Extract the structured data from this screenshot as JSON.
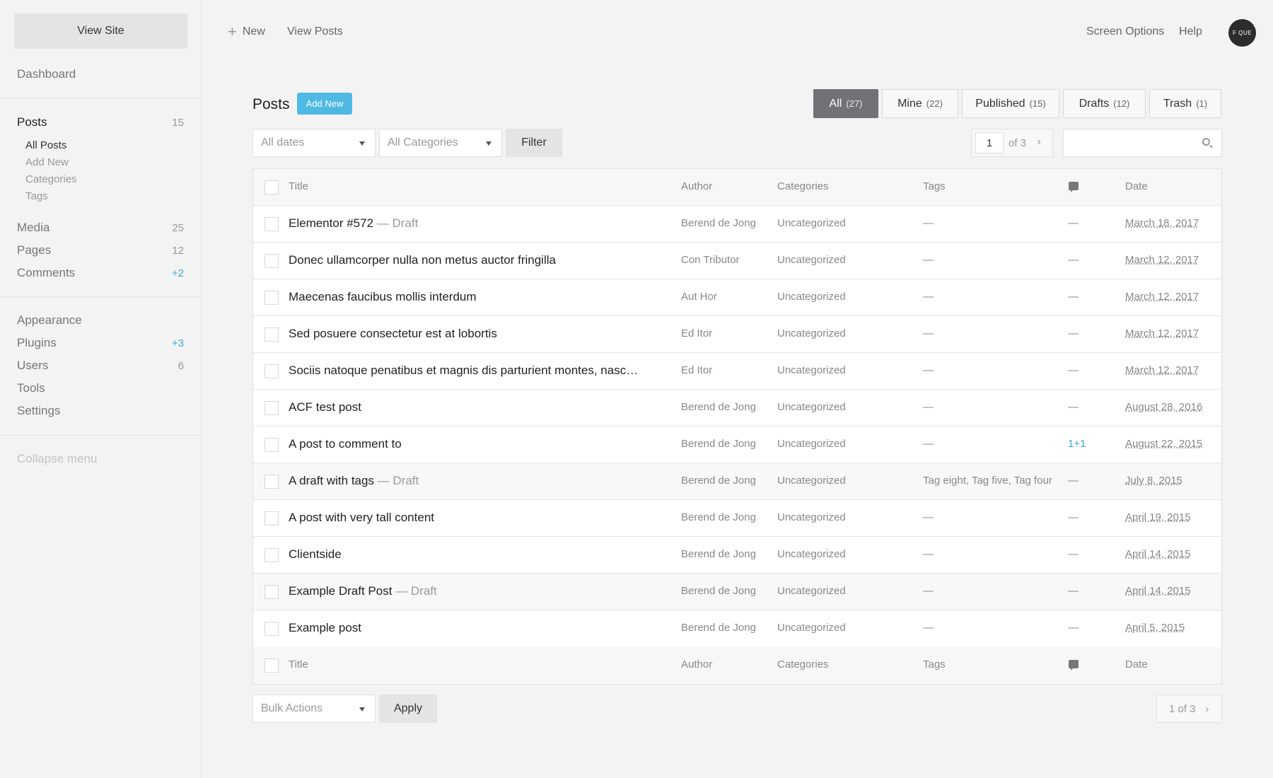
{
  "sidebar": {
    "view_site": "View Site",
    "dashboard": "Dashboard",
    "posts": {
      "label": "Posts",
      "count": "15"
    },
    "posts_sub": [
      "All Posts",
      "Add New",
      "Categories",
      "Tags"
    ],
    "media": {
      "label": "Media",
      "count": "25"
    },
    "pages": {
      "label": "Pages",
      "count": "12"
    },
    "comments": {
      "label": "Comments",
      "count": "+2"
    },
    "appearance": "Appearance",
    "plugins": {
      "label": "Plugins",
      "count": "+3"
    },
    "users": {
      "label": "Users",
      "count": "6"
    },
    "tools": "Tools",
    "settings": "Settings",
    "collapse": "Collapse menu"
  },
  "topbar": {
    "new": "New",
    "view_posts": "View Posts",
    "screen_options": "Screen Options",
    "help": "Help",
    "avatar": "F QUE"
  },
  "header": {
    "title": "Posts",
    "add_new": "Add New",
    "tabs": [
      {
        "label": "All",
        "count": "(27)"
      },
      {
        "label": "Mine",
        "count": "(22)"
      },
      {
        "label": "Published",
        "count": "(15)"
      },
      {
        "label": "Drafts",
        "count": "(12)"
      },
      {
        "label": "Trash",
        "count": "(1)"
      }
    ]
  },
  "filters": {
    "dates": "All dates",
    "categories": "All Categories",
    "filter": "Filter",
    "page": "1",
    "of": "of 3",
    "next": "›"
  },
  "table": {
    "columns": [
      "Title",
      "Author",
      "Categories",
      "Tags",
      "Date"
    ],
    "rows": [
      {
        "title": "Elementor #572",
        "status": "— Draft",
        "author": "Berend de Jong",
        "cat": "Uncategorized",
        "tags": "—",
        "com": "—",
        "date": "March 18, 2017"
      },
      {
        "title": "Donec ullamcorper nulla non metus auctor fringilla",
        "status": "",
        "author": "Con Tributor",
        "cat": "Uncategorized",
        "tags": "—",
        "com": "—",
        "date": "March 12, 2017"
      },
      {
        "title": "Maecenas faucibus mollis interdum",
        "status": "",
        "author": "Aut Hor",
        "cat": "Uncategorized",
        "tags": "—",
        "com": "—",
        "date": "March 12, 2017"
      },
      {
        "title": "Sed posuere consectetur est at lobortis",
        "status": "",
        "author": "Ed Itor",
        "cat": "Uncategorized",
        "tags": "—",
        "com": "—",
        "date": "March 12, 2017"
      },
      {
        "title": "Sociis natoque penatibus et magnis dis parturient montes, nascetur ridic...",
        "status": "",
        "author": "Ed Itor",
        "cat": "Uncategorized",
        "tags": "—",
        "com": "—",
        "date": "March 12, 2017"
      },
      {
        "title": "ACF test post",
        "status": "",
        "author": "Berend de Jong",
        "cat": "Uncategorized",
        "tags": "—",
        "com": "—",
        "date": "August 28, 2016"
      },
      {
        "title": "A post to comment to",
        "status": "",
        "author": "Berend de Jong",
        "cat": "Uncategorized",
        "tags": "—",
        "com": "1+1",
        "date": "August 22, 2015"
      },
      {
        "title": "A draft with tags",
        "status": "— Draft",
        "author": "Berend de Jong",
        "cat": "Uncategorized",
        "tags": "Tag eight, Tag five, Tag four",
        "com": "—",
        "date": "July 8, 2015"
      },
      {
        "title": "A post with very tall content",
        "status": "",
        "author": "Berend de Jong",
        "cat": "Uncategorized",
        "tags": "—",
        "com": "—",
        "date": "April 19, 2015"
      },
      {
        "title": "Clientside",
        "status": "",
        "author": "Berend de Jong",
        "cat": "Uncategorized",
        "tags": "—",
        "com": "—",
        "date": "April 14, 2015"
      },
      {
        "title": "Example Draft Post",
        "status": "— Draft",
        "author": "Berend de Jong",
        "cat": "Uncategorized",
        "tags": "—",
        "com": "—",
        "date": "April 14, 2015"
      },
      {
        "title": "Example post",
        "status": "",
        "author": "Berend de Jong",
        "cat": "Uncategorized",
        "tags": "—",
        "com": "—",
        "date": "April 5, 2015"
      }
    ]
  },
  "bottom": {
    "bulk": "Bulk Actions",
    "apply": "Apply",
    "pages": "1 of 3",
    "next": "›"
  }
}
